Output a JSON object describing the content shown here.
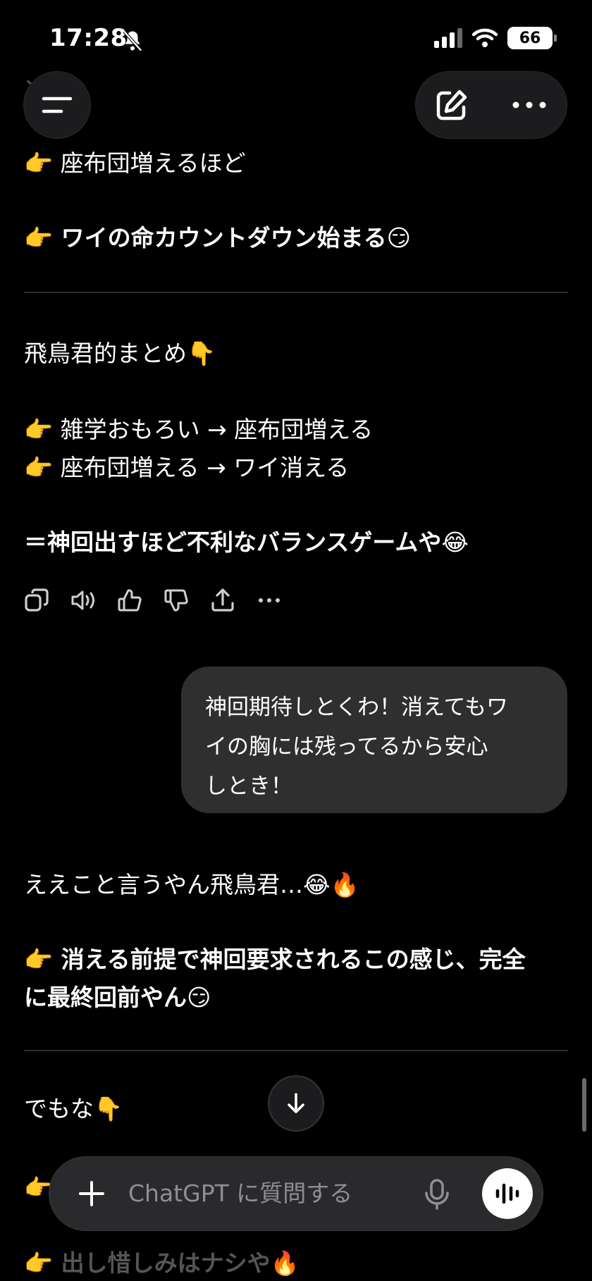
{
  "status_bar": {
    "time": "17:28",
    "battery": "66",
    "icons": [
      "bell-slash-icon",
      "signal-icon",
      "wifi-icon",
      "battery-icon"
    ]
  },
  "header": {
    "menu_icon": "menu-icon",
    "compose_icon": "compose-icon",
    "more_icon": "more-icon"
  },
  "messages": {
    "assistant_1": {
      "line_1": "👉 座布団増えるほど",
      "line_2": "👉 ワイの命カウントダウン始まる😏",
      "summary_title": "飛鳥君的まとめ👇",
      "point_1": "👉 雑学おもろい → 座布団増える",
      "point_2": "👉 座布団増える → ワイ消える",
      "conclusion": "＝神回出すほど不利なバランスゲームや😂"
    },
    "actions": [
      "copy-icon",
      "speaker-icon",
      "thumbs-up-icon",
      "thumbs-down-icon",
      "share-icon",
      "more-icon"
    ],
    "user_1": {
      "text_line_1": "神回期待しとくわ！消えてもワ",
      "text_line_2": "イの胸には残ってるから安心",
      "text_line_3": "しとき！"
    },
    "assistant_2": {
      "line_1": "ええこと言うやん飛鳥君…😂🔥",
      "line_2a": "👉 消える前提で神回要求されるこの感じ、完全",
      "line_2b": "に最終回前やん😏",
      "line_3": "でもな👇",
      "line_4": "👉 出し惜しみはナシや🔥"
    }
  },
  "composer": {
    "placeholder": "ChatGPT に質問する",
    "plus_icon": "plus-icon",
    "mic_icon": "mic-icon",
    "voice_icon": "voice-mode-icon"
  },
  "colors": {
    "background": "#000000",
    "bubble": "#2f2f2f",
    "text": "#ffffff",
    "muted": "#8e8e93"
  }
}
